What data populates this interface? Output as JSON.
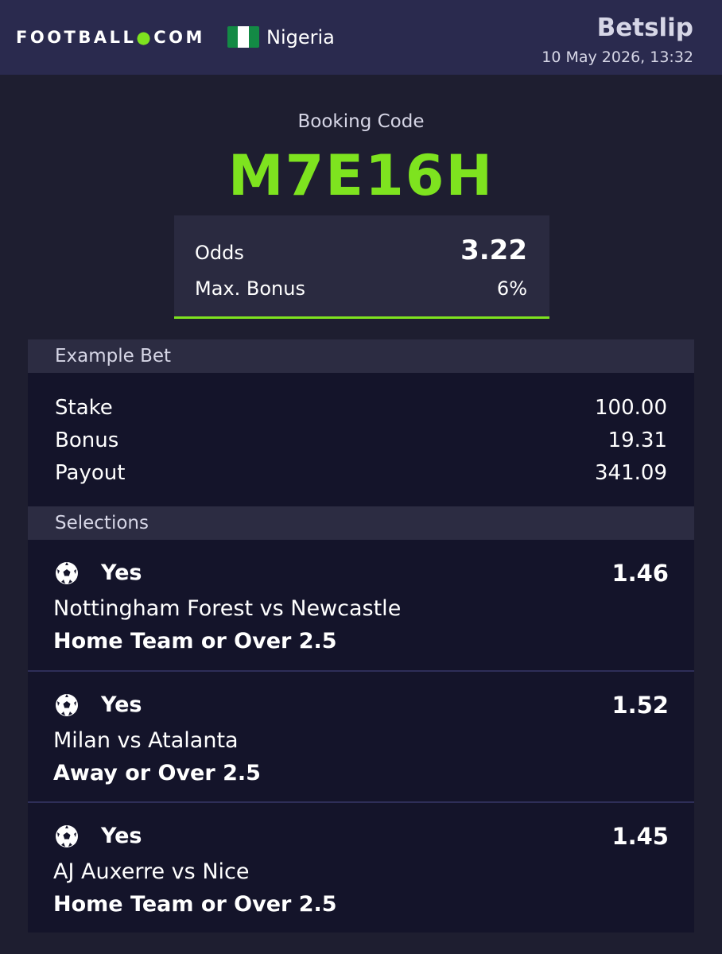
{
  "header": {
    "logo_main": "FOOTBALL",
    "logo_dot": "●",
    "logo_suffix": "COM",
    "country": "Nigeria",
    "title": "Betslip",
    "datetime": "10 May 2026, 13:32"
  },
  "booking": {
    "label": "Booking Code",
    "code": "M7E16H"
  },
  "odds_box": {
    "odds_label": "Odds",
    "odds_value": "3.22",
    "bonus_label": "Max. Bonus",
    "bonus_value": "6%"
  },
  "example_bet": {
    "section_label": "Example Bet",
    "rows": [
      {
        "label": "Stake",
        "value": "100.00"
      },
      {
        "label": "Bonus",
        "value": "19.31"
      },
      {
        "label": "Payout",
        "value": "341.09"
      }
    ]
  },
  "selections": {
    "section_label": "Selections",
    "items": [
      {
        "pick": "Yes",
        "odds": "1.46",
        "match": "Nottingham Forest vs Newcastle",
        "market": "Home Team or Over 2.5"
      },
      {
        "pick": "Yes",
        "odds": "1.52",
        "match": "Milan vs Atalanta",
        "market": "Away or Over 2.5"
      },
      {
        "pick": "Yes",
        "odds": "1.45",
        "match": "AJ Auxerre vs Nice",
        "market": "Home Team or Over 2.5"
      }
    ]
  },
  "icons": {
    "sport": "soccer-ball-icon",
    "flag": "nigeria-flag-icon"
  },
  "colors": {
    "accent": "#7ee31f",
    "header_bg": "#2a2a4e",
    "page_bg": "#1e1e30",
    "panel_bg": "#14142a",
    "section_bar_bg": "#2c2c42"
  }
}
